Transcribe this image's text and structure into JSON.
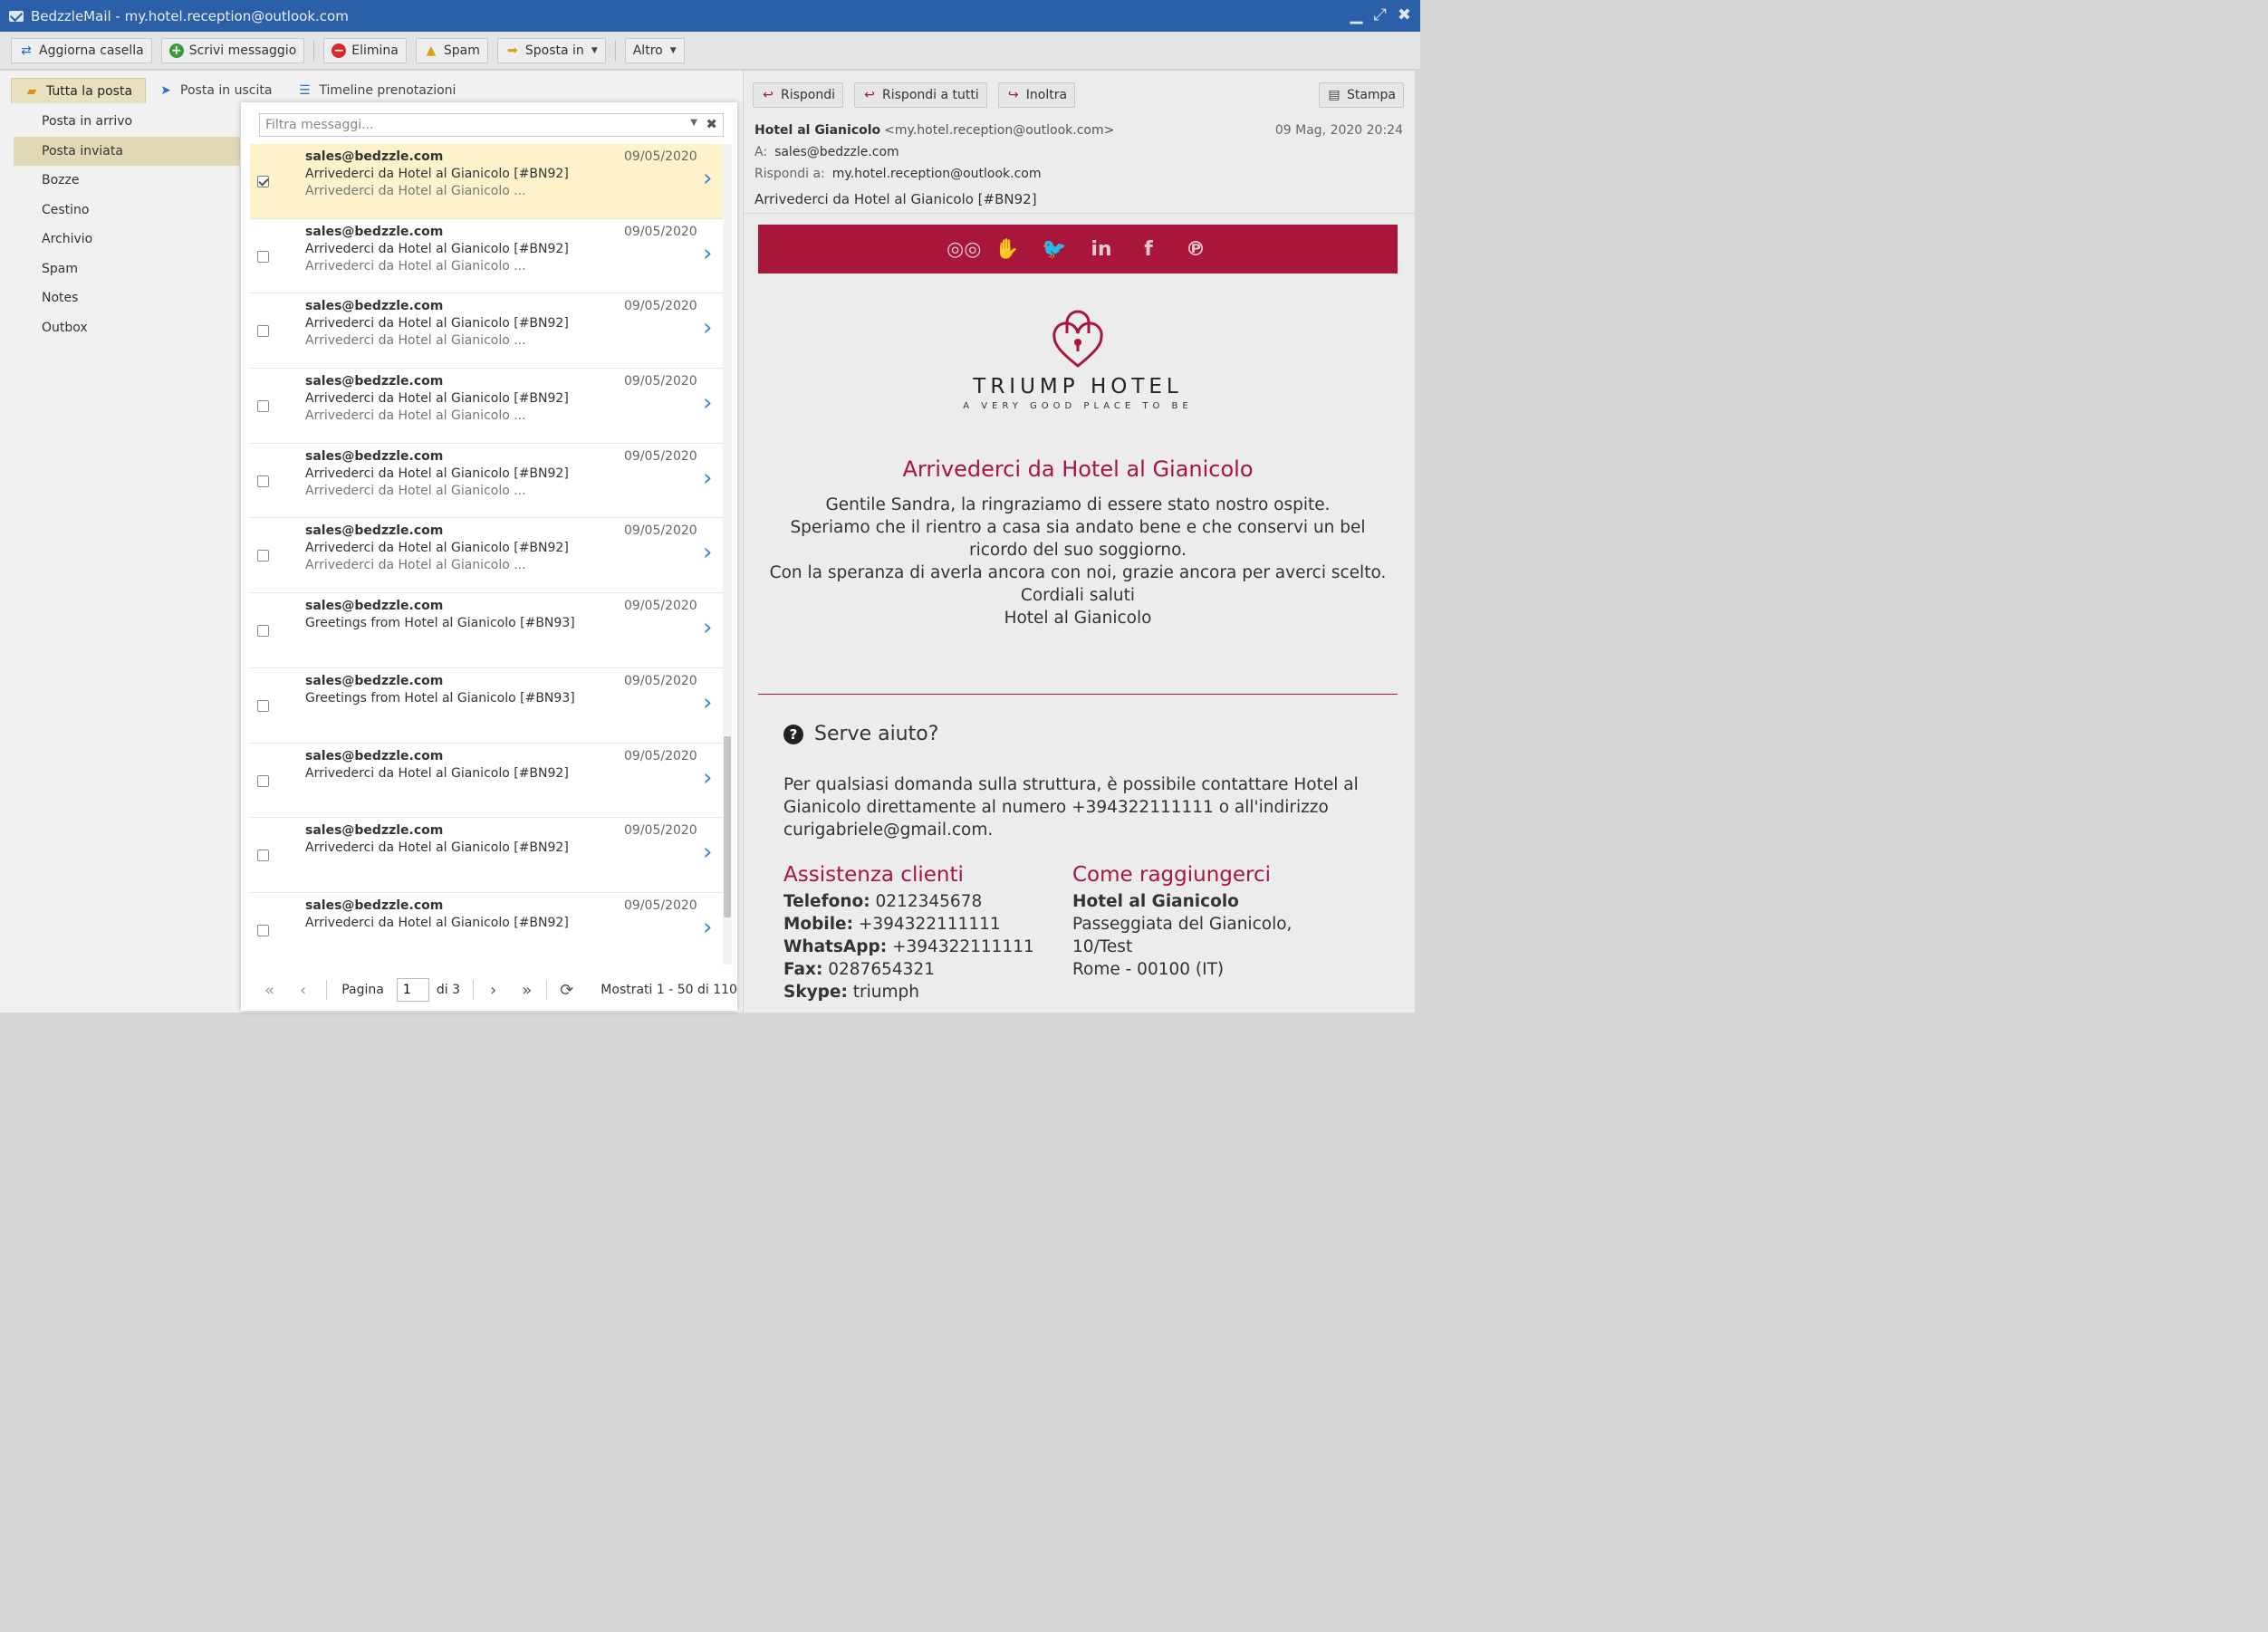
{
  "window": {
    "title": "BedzzleMail - my.hotel.reception@outlook.com"
  },
  "toolbar": {
    "refresh": "Aggiorna casella",
    "compose": "Scrivi messaggio",
    "delete": "Elimina",
    "spam": "Spam",
    "move": "Sposta in",
    "more": "Altro"
  },
  "tabs": [
    "Tutta la posta",
    "Posta in uscita",
    "Timeline prenotazioni"
  ],
  "folders": [
    "Posta in arrivo",
    "Posta inviata",
    "Bozze",
    "Cestino",
    "Archivio",
    "Spam",
    "Notes",
    "Outbox"
  ],
  "list": {
    "filter_placeholder": "Filtra messaggi...",
    "messages": [
      {
        "from": "sales@bedzzle.com",
        "date": "09/05/2020",
        "subject": "Arrivederci da Hotel al Gianicolo [#BN92]",
        "preview": "Arrivederci da Hotel al Gianicolo ..."
      },
      {
        "from": "sales@bedzzle.com",
        "date": "09/05/2020",
        "subject": "Arrivederci da Hotel al Gianicolo [#BN92]",
        "preview": "Arrivederci da Hotel al Gianicolo ..."
      },
      {
        "from": "sales@bedzzle.com",
        "date": "09/05/2020",
        "subject": "Arrivederci da Hotel al Gianicolo [#BN92]",
        "preview": "Arrivederci da Hotel al Gianicolo ..."
      },
      {
        "from": "sales@bedzzle.com",
        "date": "09/05/2020",
        "subject": "Arrivederci da Hotel al Gianicolo [#BN92]",
        "preview": "Arrivederci da Hotel al Gianicolo ..."
      },
      {
        "from": "sales@bedzzle.com",
        "date": "09/05/2020",
        "subject": "Arrivederci da Hotel al Gianicolo [#BN92]",
        "preview": "Arrivederci da Hotel al Gianicolo ..."
      },
      {
        "from": "sales@bedzzle.com",
        "date": "09/05/2020",
        "subject": "Arrivederci da Hotel al Gianicolo [#BN92]",
        "preview": "Arrivederci da Hotel al Gianicolo ..."
      },
      {
        "from": "sales@bedzzle.com",
        "date": "09/05/2020",
        "subject": "Greetings from Hotel al Gianicolo [#BN93]",
        "preview": ""
      },
      {
        "from": "sales@bedzzle.com",
        "date": "09/05/2020",
        "subject": "Greetings from Hotel al Gianicolo [#BN93]",
        "preview": ""
      },
      {
        "from": "sales@bedzzle.com",
        "date": "09/05/2020",
        "subject": "Arrivederci da Hotel al Gianicolo [#BN92]",
        "preview": ""
      },
      {
        "from": "sales@bedzzle.com",
        "date": "09/05/2020",
        "subject": "Arrivederci da Hotel al Gianicolo [#BN92]",
        "preview": ""
      },
      {
        "from": "sales@bedzzle.com",
        "date": "09/05/2020",
        "subject": "Arrivederci da Hotel al Gianicolo [#BN92]",
        "preview": ""
      }
    ],
    "pager": {
      "page_label": "Pagina",
      "page_value": "1",
      "of_label": "di 3",
      "summary": "Mostrati 1 - 50 di 110"
    }
  },
  "reader": {
    "reply": "Rispondi",
    "reply_all": "Rispondi a tutti",
    "forward": "Inoltra",
    "print": "Stampa",
    "sender_name": "Hotel al Gianicolo",
    "sender_addr": "<my.hotel.reception@outlook.com>",
    "date": "09 Mag, 2020 20:24",
    "to_label": "A:",
    "to": "sales@bedzzle.com",
    "reply_to_label": "Rispondi a:",
    "reply_to": "my.hotel.reception@outlook.com",
    "subject": "Arrivederci da Hotel al Gianicolo [#BN92]"
  },
  "email": {
    "brand": "TRIUMP HOTEL",
    "tagline": "A VERY GOOD PLACE TO BE",
    "title": "Arrivederci da Hotel al Gianicolo",
    "body_lines": [
      "Gentile Sandra, la ringraziamo di essere stato nostro ospite.",
      "Speriamo che il rientro a casa sia andato bene e che conservi un bel",
      "ricordo del suo soggiorno.",
      "Con la speranza di averla ancora con noi, grazie ancora per averci scelto.",
      "Cordiali saluti",
      "Hotel al Gianicolo"
    ],
    "help_title": "Serve aiuto?",
    "help_text": "Per qualsiasi domanda sulla struttura, è possibile contattare Hotel al Gianicolo direttamente al numero +394322111111 o all'indirizzo curigabriele@gmail.com.",
    "assist": {
      "title": "Assistenza clienti",
      "phone_label": "Telefono:",
      "phone": "0212345678",
      "mobile_label": "Mobile:",
      "mobile": "+394322111111",
      "whatsapp_label": "WhatsApp:",
      "whatsapp": "+394322111111",
      "fax_label": "Fax:",
      "fax": "0287654321",
      "skype_label": "Skype:",
      "skype": "triumph"
    },
    "reach": {
      "title": "Come raggiungerci",
      "name": "Hotel al Gianicolo",
      "addr1": "Passeggiata del Gianicolo,",
      "addr2": "10/Test",
      "addr3": "Rome - 00100 (IT)"
    }
  },
  "colors": {
    "titlebar": "#2b5fa8",
    "brand": "#a8163c",
    "selected_row": "#fdf2c9",
    "link_chevron": "#3a86d8"
  }
}
